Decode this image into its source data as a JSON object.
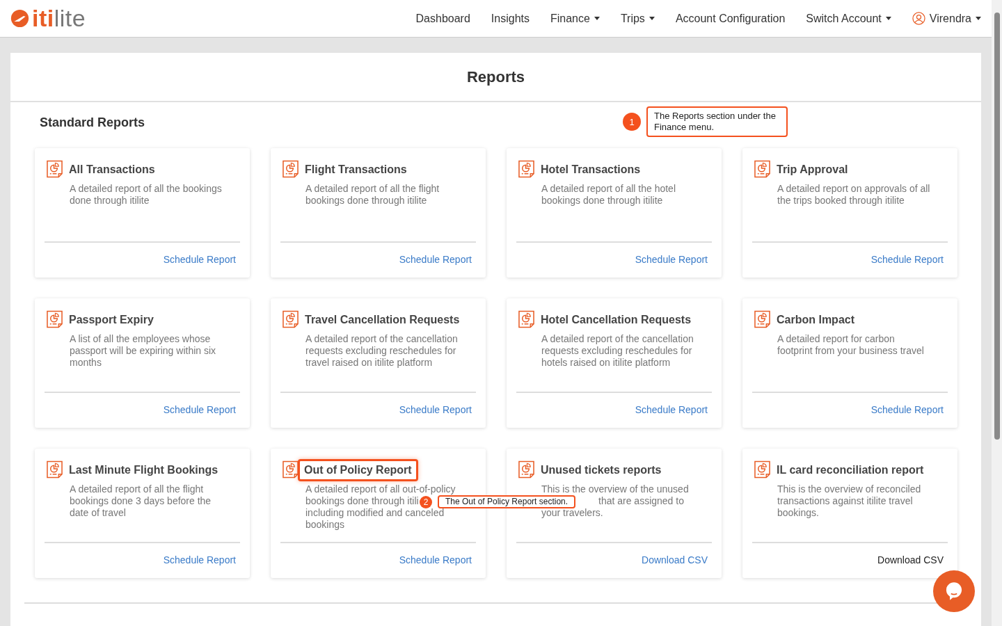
{
  "nav": {
    "brand": {
      "part1": "iti",
      "part2": "lite"
    },
    "items": [
      {
        "label": "Dashboard",
        "dropdown": false
      },
      {
        "label": "Insights",
        "dropdown": false
      },
      {
        "label": "Finance",
        "dropdown": true
      },
      {
        "label": "Trips",
        "dropdown": true
      },
      {
        "label": "Account Configuration",
        "dropdown": false
      },
      {
        "label": "Switch Account",
        "dropdown": true
      }
    ],
    "user": {
      "name": "Virendra"
    }
  },
  "page_title": "Reports",
  "section_title": "Standard Reports",
  "cards": [
    {
      "title": "All Transactions",
      "description": [
        {
          "text": "A detailed report of all the bookings"
        },
        {
          "text": "done through itilite"
        }
      ],
      "action": {
        "label": "Schedule Report",
        "kind": "link"
      },
      "highlighted": false
    },
    {
      "title": "Flight Transactions",
      "description": [
        {
          "text": "A detailed report of all the flight"
        },
        {
          "text": "bookings done through itilite"
        }
      ],
      "action": {
        "label": "Schedule Report",
        "kind": "link"
      },
      "highlighted": false
    },
    {
      "title": "Hotel Transactions",
      "description": [
        {
          "text": "A detailed report of all the hotel"
        },
        {
          "text": "bookings done through itilite"
        }
      ],
      "action": {
        "label": "Schedule Report",
        "kind": "link"
      },
      "highlighted": false
    },
    {
      "title": "Trip Approval",
      "description": [
        {
          "text": "A detailed report on approvals of all"
        },
        {
          "text": "the trips booked through itilite"
        }
      ],
      "action": {
        "label": "Schedule Report",
        "kind": "link"
      },
      "highlighted": false
    },
    {
      "title": "Passport Expiry",
      "description": [
        {
          "text": "A list of all the employees whose"
        },
        {
          "text": "passport will be expiring within six"
        },
        {
          "text": "months"
        }
      ],
      "action": {
        "label": "Schedule Report",
        "kind": "link"
      },
      "highlighted": false
    },
    {
      "title": "Travel Cancellation Requests",
      "description": [
        {
          "text": "A detailed report of the cancellation"
        },
        {
          "text": "requests excluding reschedules for"
        },
        {
          "text": "travel raised on itilite platform"
        }
      ],
      "action": {
        "label": "Schedule Report",
        "kind": "link"
      },
      "highlighted": false
    },
    {
      "title": "Hotel Cancellation Requests",
      "description": [
        {
          "text": "A detailed report of the cancellation"
        },
        {
          "text": "requests excluding reschedules for"
        },
        {
          "text": "hotels raised on itilite platform"
        }
      ],
      "action": {
        "label": "Schedule Report",
        "kind": "link"
      },
      "highlighted": false
    },
    {
      "title": "Carbon Impact",
      "description": [
        {
          "text": "A detailed report for carbon"
        },
        {
          "text": "footprint from your business travel"
        }
      ],
      "action": {
        "label": "Schedule Report",
        "kind": "link"
      },
      "highlighted": false
    },
    {
      "title": "Last Minute Flight Bookings",
      "description": [
        {
          "text": "A detailed report of all the flight"
        },
        {
          "text": "bookings done 3 days before the"
        },
        {
          "text": "date of travel"
        }
      ],
      "action": {
        "label": "Schedule Report",
        "kind": "link"
      },
      "highlighted": false
    },
    {
      "title": "Out of Policy Report",
      "description": [
        {
          "text": "A detailed report of all out-of-policy"
        },
        {
          "text": "bookings done through itili"
        },
        {
          "text": "including modified and canceled"
        },
        {
          "text": "bookings"
        }
      ],
      "action": {
        "label": "Schedule Report",
        "kind": "link"
      },
      "highlighted": true
    },
    {
      "title": "Unused tickets reports",
      "description": [
        {
          "text": "This is the overview of the unused"
        },
        {
          "text": "that are assigned to",
          "indented": true
        },
        {
          "text": "your travelers."
        }
      ],
      "action": {
        "label": "Download CSV",
        "kind": "link"
      },
      "highlighted": false
    },
    {
      "title": "IL card reconciliation report",
      "description": [
        {
          "text": "This is the overview of reconciled"
        },
        {
          "text": "transactions against itilite travel"
        },
        {
          "text": "bookings."
        }
      ],
      "action": {
        "label": "Download CSV",
        "kind": "plain"
      },
      "highlighted": false
    }
  ],
  "callouts": [
    {
      "number": "1",
      "text": "The Reports section under the Finance menu."
    },
    {
      "number": "2",
      "text": "The Out of Policy Report section."
    }
  ]
}
